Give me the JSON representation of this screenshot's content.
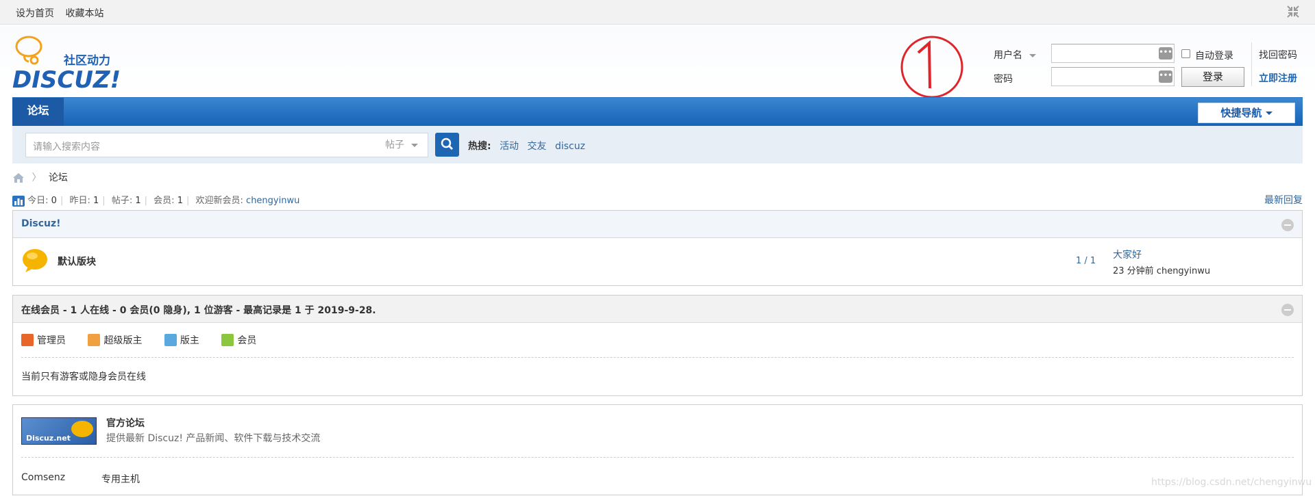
{
  "topbar": {
    "set_home": "设为首页",
    "bookmark": "收藏本站"
  },
  "logo": {
    "cn": "社区动力",
    "en": "DISCUZ!"
  },
  "login": {
    "username_label": "用户名",
    "password_label": "密码",
    "auto_login": "自动登录",
    "find_password": "找回密码",
    "register": "立即注册",
    "login_button": "登录"
  },
  "nav": {
    "tab": "论坛",
    "quick_nav": "快捷导航"
  },
  "search": {
    "placeholder": "请输入搜索内容",
    "category": "帖子",
    "hot_label": "热搜:",
    "hot_links": [
      "活动",
      "交友",
      "discuz"
    ]
  },
  "breadcrumb": {
    "current": "论坛"
  },
  "stats": {
    "today_label": "今日:",
    "today": "0",
    "yesterday_label": "昨日:",
    "yesterday": "1",
    "posts_label": "帖子:",
    "posts": "1",
    "members_label": "会员:",
    "members": "1",
    "welcome_label": "欢迎新会员:",
    "new_member": "chengyinwu",
    "latest_reply": "最新回复"
  },
  "forum": {
    "category": "Discuz!",
    "board_name": "默认版块",
    "counts": "1 / 1",
    "last_title": "大家好",
    "last_time": "23 分钟前 chengyinwu"
  },
  "online": {
    "header": "在线会员 - 1 人在线 - 0 会员(0 隐身), 1 位游客 - 最高记录是 1 于 2019-9-28.",
    "legend": [
      "管理员",
      "超级版主",
      "版主",
      "会员"
    ],
    "legend_colors": [
      "#e8662a",
      "#f0a040",
      "#5aa8e0",
      "#8cc63f"
    ],
    "note": "当前只有游客或隐身会员在线"
  },
  "links": {
    "official_title": "官方论坛",
    "official_desc": "提供最新 Discuz! 产品新闻、软件下载与技术交流",
    "banner_text": "Discuz.net",
    "text_links": [
      "Comsenz",
      "专用主机"
    ]
  },
  "annotation": {
    "circled_mark": "①"
  },
  "watermark": "https://blog.csdn.net/chengyinwu"
}
